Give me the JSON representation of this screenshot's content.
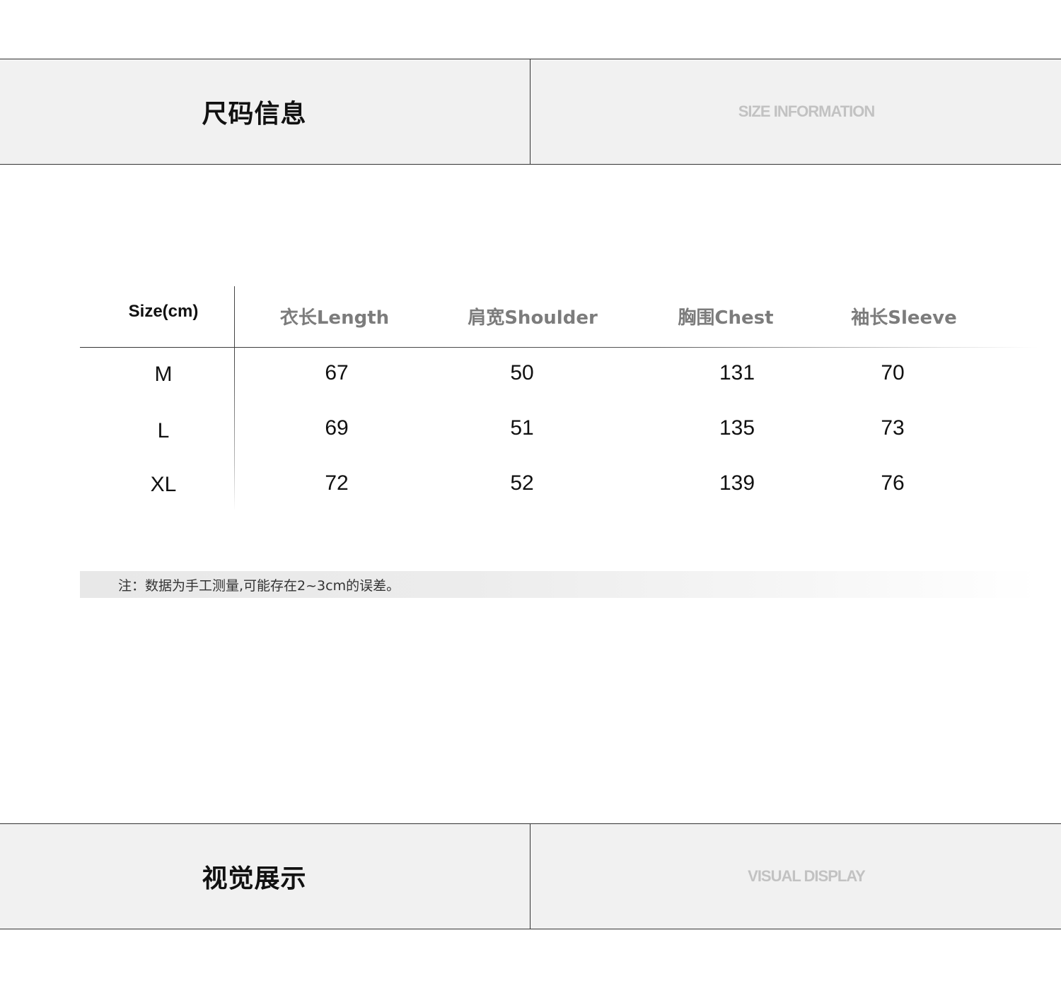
{
  "size_section": {
    "title_cn": "尺码信息",
    "title_en": "SIZE INFORMATION"
  },
  "size_table": {
    "headers": [
      "Size(cm)",
      "衣长Length",
      "肩宽Shoulder",
      "胸围Chest",
      "袖长Sleeve"
    ],
    "rows": [
      [
        "M",
        "67",
        "50",
        "131",
        "70"
      ],
      [
        "L",
        "69",
        "51",
        "135",
        "73"
      ],
      [
        "XL",
        "72",
        "52",
        "139",
        "76"
      ]
    ]
  },
  "note": "注：数据为手工测量,可能存在2~3cm的误差。",
  "visual_section": {
    "title_cn": "视觉展示",
    "title_en": "VISUAL DISPLAY"
  }
}
